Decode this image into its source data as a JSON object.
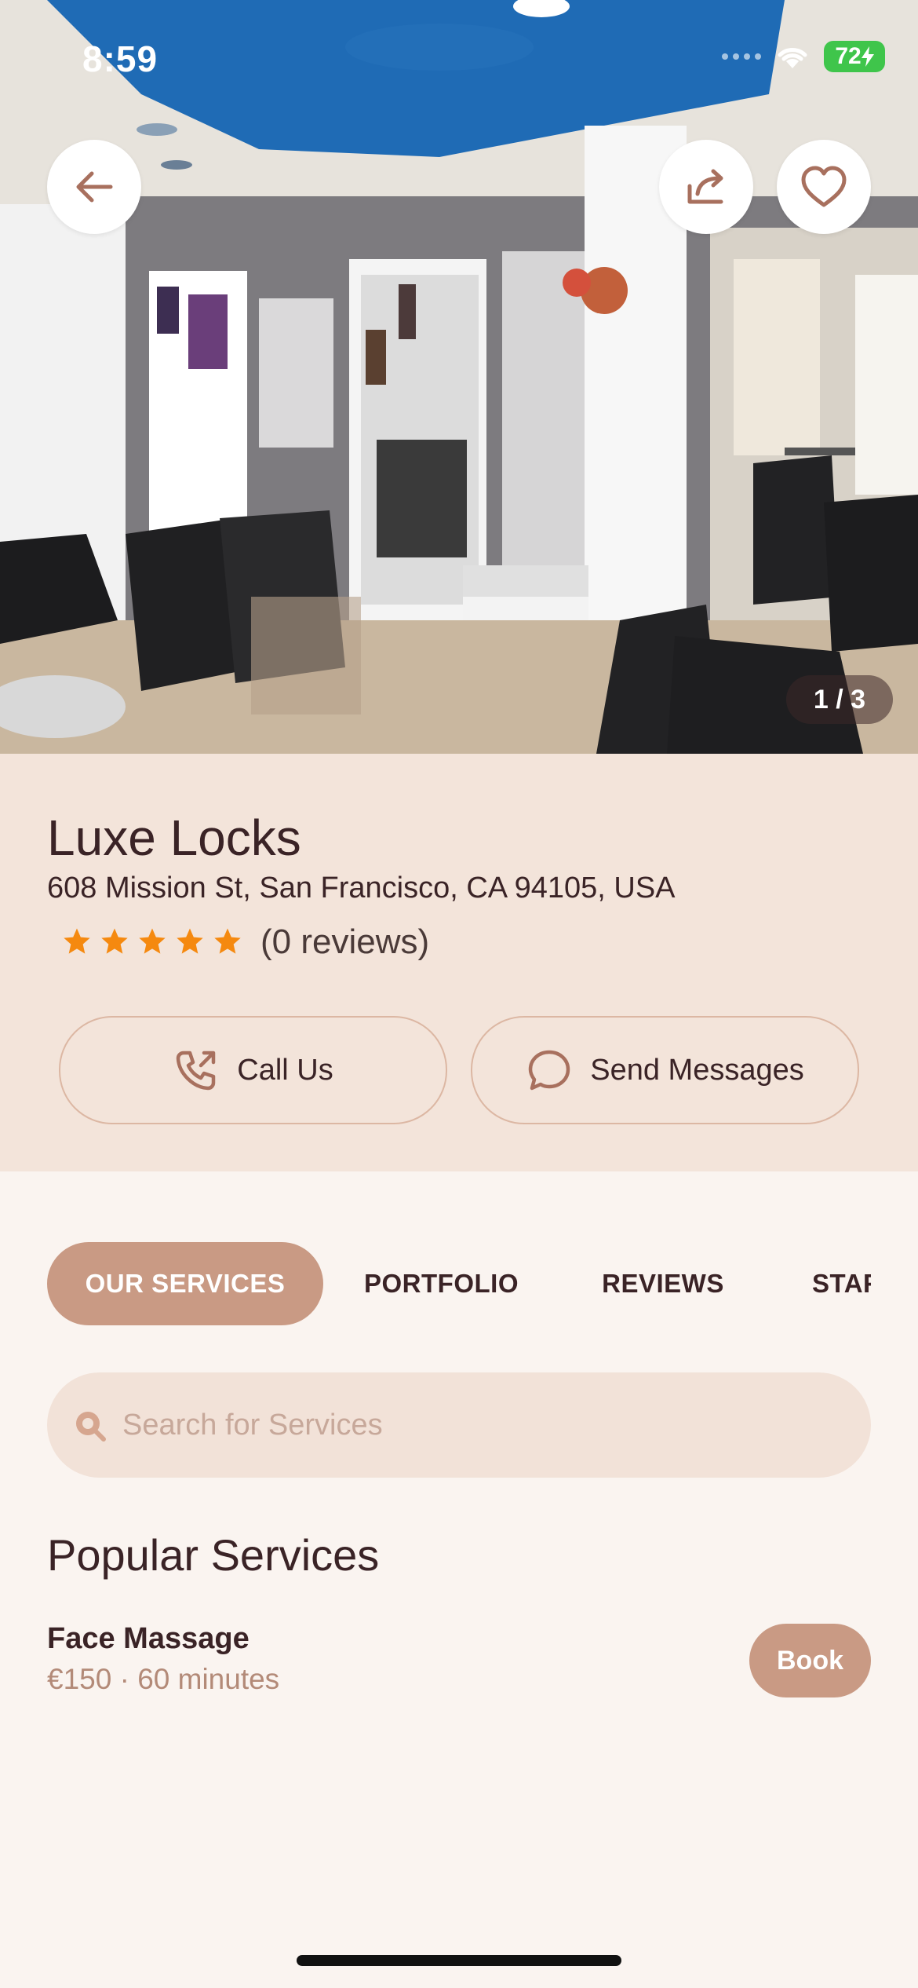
{
  "status_bar": {
    "time": "8:59",
    "battery": "72"
  },
  "hero": {
    "pager": "1 / 3"
  },
  "salon": {
    "name": "Luxe Locks",
    "address": "608 Mission St, San Francisco, CA 94105, USA",
    "rating_stars": 5,
    "reviews": "(0 reviews)"
  },
  "actions": {
    "call_label": "Call Us",
    "message_label": "Send Messages"
  },
  "tabs": [
    {
      "label": "OUR SERVICES",
      "active": true
    },
    {
      "label": "PORTFOLIO",
      "active": false
    },
    {
      "label": "REVIEWS",
      "active": false
    },
    {
      "label": "STAFF",
      "active": false
    }
  ],
  "search": {
    "placeholder": "Search for Services",
    "value": ""
  },
  "popular": {
    "title": "Popular Services",
    "items": [
      {
        "name": "Face Massage",
        "meta": "€150 · 60 minutes",
        "action": "Book"
      }
    ]
  },
  "colors": {
    "accent": "#c99a84",
    "info_bg": "#f3e4da",
    "page_bg": "#faf4f0",
    "star": "#f5890f",
    "text": "#3a2326"
  },
  "icons": {
    "back": "arrow-left-icon",
    "share": "share-icon",
    "favorite": "heart-icon",
    "call": "phone-outgoing-icon",
    "message": "chat-bubble-icon",
    "search": "search-icon",
    "star": "star-icon"
  }
}
